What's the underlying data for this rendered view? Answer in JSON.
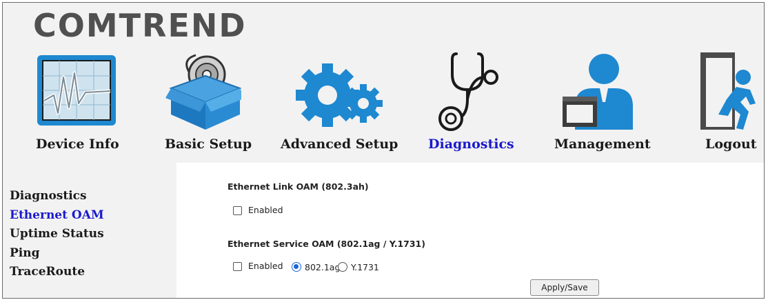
{
  "brand": {
    "logo_text": "COMTREND"
  },
  "nav": {
    "items": [
      {
        "label": "Device Info",
        "icon": "device-info-monitor-icon",
        "active": false
      },
      {
        "label": "Basic Setup",
        "icon": "basic-setup-box-icon",
        "active": false
      },
      {
        "label": "Advanced Setup",
        "icon": "advanced-setup-gears-icon",
        "active": false
      },
      {
        "label": "Diagnostics",
        "icon": "diagnostics-stethoscope-icon",
        "active": true
      },
      {
        "label": "Management",
        "icon": "management-user-icon",
        "active": false
      },
      {
        "label": "Logout",
        "icon": "logout-exit-icon",
        "active": false
      }
    ]
  },
  "sidebar": {
    "items": [
      {
        "label": "Diagnostics",
        "active": false
      },
      {
        "label": "Ethernet OAM",
        "active": true
      },
      {
        "label": "Uptime Status",
        "active": false
      },
      {
        "label": "Ping",
        "active": false
      },
      {
        "label": "TraceRoute",
        "active": false
      }
    ]
  },
  "content": {
    "link_oam": {
      "title": "Ethernet Link OAM (802.3ah)",
      "enabled_label": "Enabled",
      "enabled": false
    },
    "service_oam": {
      "title": "Ethernet Service OAM (802.1ag / Y.1731)",
      "enabled_label": "Enabled",
      "enabled": false,
      "options": [
        {
          "label": "802.1ag",
          "selected": true
        },
        {
          "label": "Y.1731",
          "selected": false
        }
      ]
    },
    "apply_label": "Apply/Save"
  },
  "colors": {
    "active_link": "#1a1acc",
    "header_bg": "#f2f2f2",
    "icon_blue": "#1e88d0",
    "icon_dark": "#3c3c3c"
  }
}
